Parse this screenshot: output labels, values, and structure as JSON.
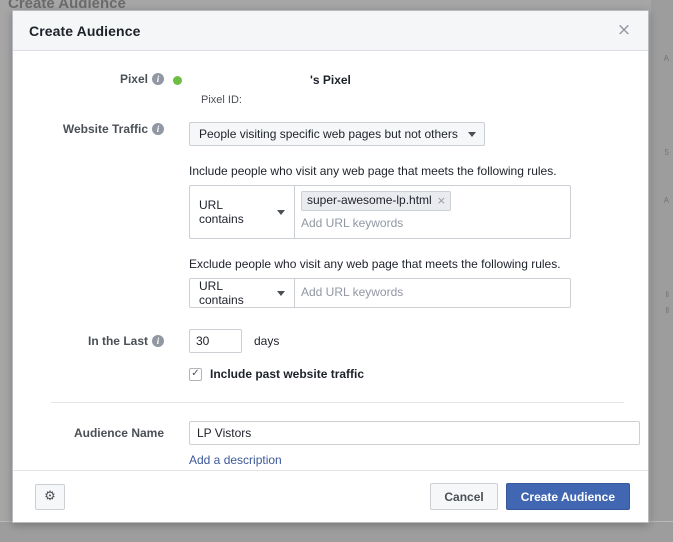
{
  "background": {
    "title_fragment": "Create Audience",
    "right_fragments": [
      "A",
      "5",
      "A",
      "li",
      "ll"
    ]
  },
  "modal": {
    "title": "Create Audience",
    "close_icon": "×",
    "pixel": {
      "label": "Pixel",
      "info_icon": "i",
      "status_dot_color": "#6ebe45",
      "name": "'s Pixel",
      "pixel_id_label": "Pixel ID:"
    },
    "website_traffic": {
      "label": "Website Traffic",
      "info_icon": "i",
      "selected_option": "People visiting specific web pages but not others",
      "caret_icon": "chevron-down"
    },
    "include_rules": {
      "description": "Include people who visit any web page that meets the following rules.",
      "operator": "URL contains",
      "tokens": [
        {
          "text": "super-awesome-lp.html",
          "remove_icon": "×"
        }
      ],
      "input_placeholder": "Add URL keywords",
      "input_value": ""
    },
    "exclude_rules": {
      "description": "Exclude people who visit any web page that meets the following rules.",
      "operator": "URL contains",
      "tokens": [],
      "input_placeholder": "Add URL keywords",
      "input_value": ""
    },
    "in_the_last": {
      "label": "In the Last",
      "info_icon": "i",
      "value": "30",
      "unit": "days"
    },
    "include_past_traffic": {
      "checked_icon": "✓",
      "label": "Include past website traffic"
    },
    "audience_name": {
      "label": "Audience Name",
      "value": "LP Vistors",
      "placeholder": "",
      "description_link": "Add a description"
    },
    "footer": {
      "gear_icon": "⚙",
      "cancel_label": "Cancel",
      "create_label": "Create Audience",
      "primary_color": "#4267b2"
    }
  }
}
